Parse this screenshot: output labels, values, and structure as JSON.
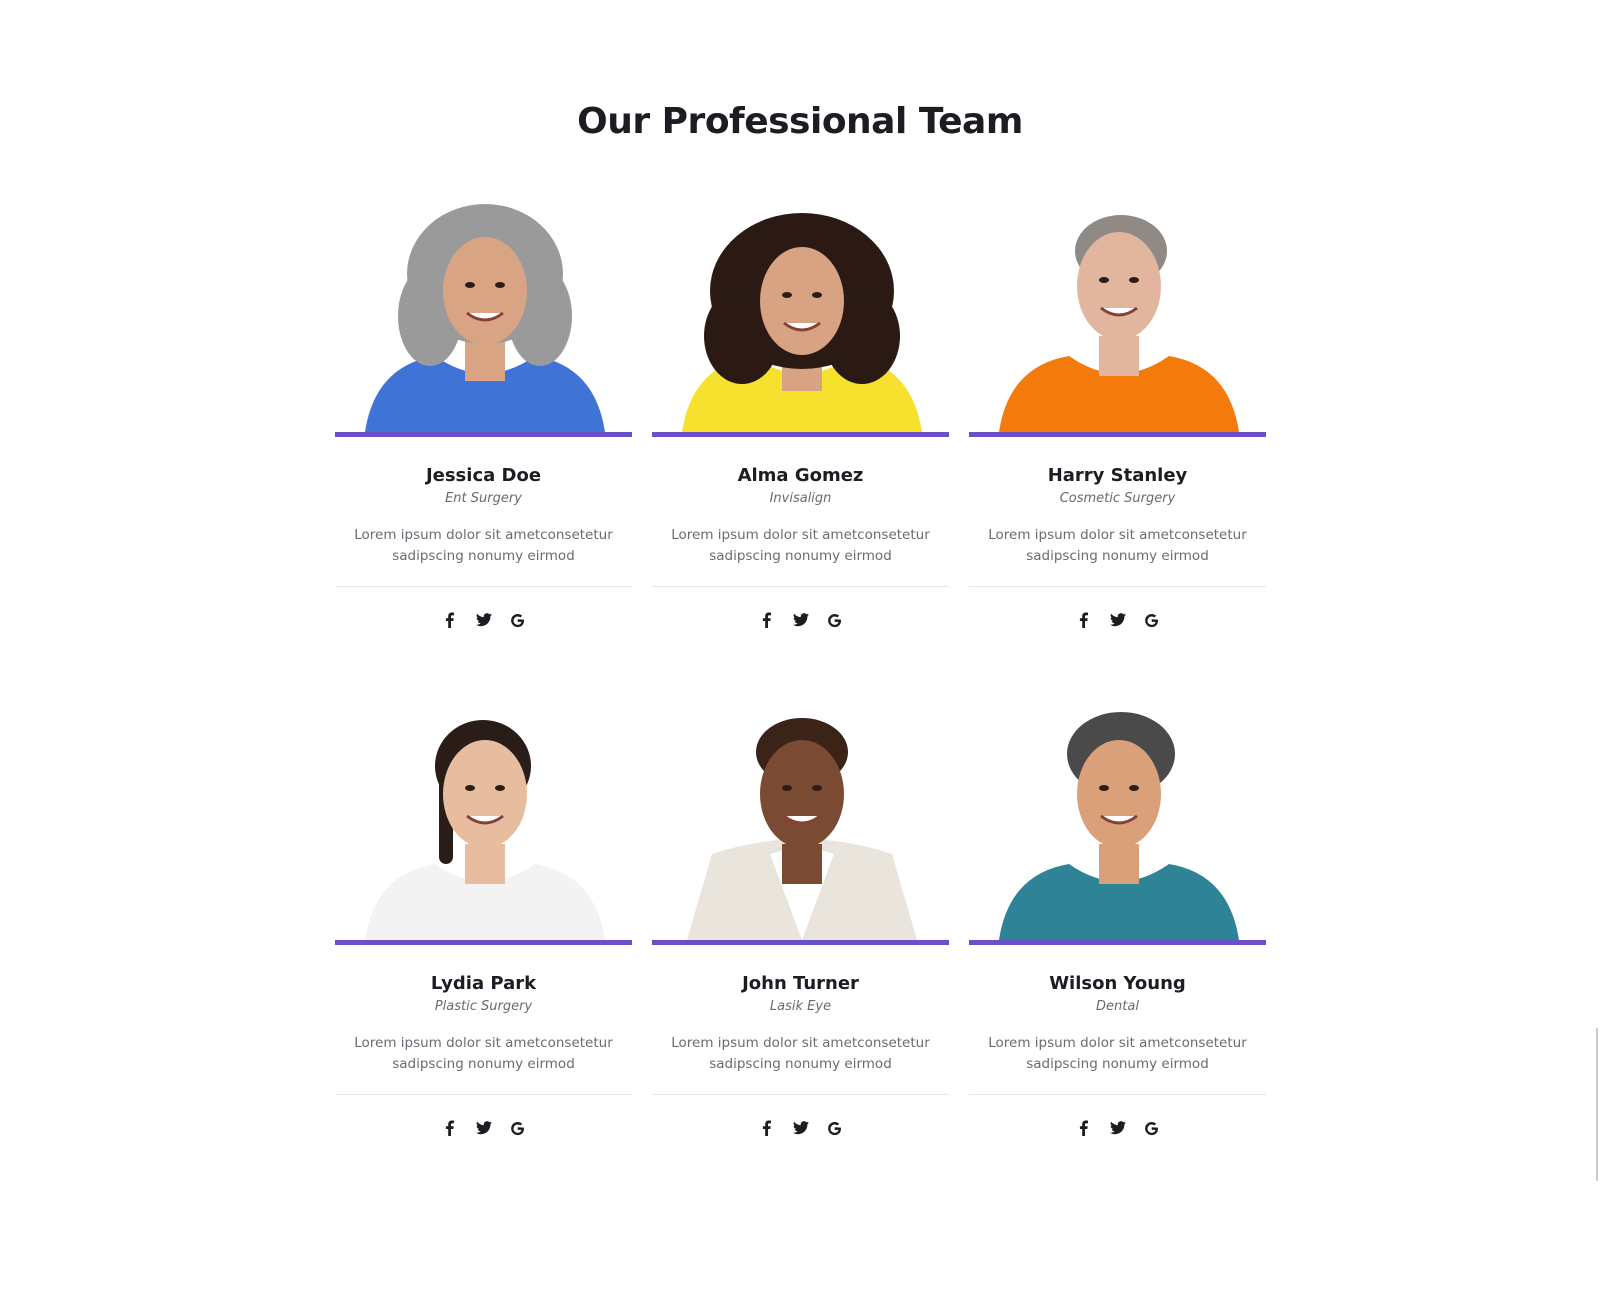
{
  "section": {
    "title": "Our Professional Team"
  },
  "accent_color": "#6a4fc8",
  "members": [
    {
      "name": "Jessica Doe",
      "role": "Ent Surgery",
      "description": "Lorem ipsum dolor sit ametconsetetur sadipscing nonumy eirmod",
      "shirt_color": "#3f73d6",
      "hair_color": "#9a9a9a",
      "skin_color": "#d9a484",
      "socials": [
        "facebook-icon",
        "twitter-icon",
        "google-icon"
      ]
    },
    {
      "name": "Alma Gomez",
      "role": "Invisalign",
      "description": "Lorem ipsum dolor sit ametconsetetur sadipscing nonumy eirmod",
      "shirt_color": "#f6e22e",
      "hair_color": "#2b1a14",
      "skin_color": "#d8a383",
      "socials": [
        "facebook-icon",
        "twitter-icon",
        "google-icon"
      ]
    },
    {
      "name": "Harry Stanley",
      "role": "Cosmetic Surgery",
      "description": "Lorem ipsum dolor sit ametconsetetur sadipscing nonumy eirmod",
      "shirt_color": "#f57a0c",
      "hair_color": "#8f8a86",
      "skin_color": "#e2b69e",
      "socials": [
        "facebook-icon",
        "twitter-icon",
        "google-icon"
      ]
    },
    {
      "name": "Lydia Park",
      "role": "Plastic Surgery",
      "description": "Lorem ipsum dolor sit ametconsetetur sadipscing nonumy eirmod",
      "shirt_color": "#f3f3f3",
      "hair_color": "#2a1c16",
      "skin_color": "#e8bd9f",
      "socials": [
        "facebook-icon",
        "twitter-icon",
        "google-icon"
      ]
    },
    {
      "name": "John Turner",
      "role": "Lasik Eye",
      "description": "Lorem ipsum dolor sit ametconsetetur sadipscing nonumy eirmod",
      "shirt_color": "#e9e4dc",
      "hair_color": "#3b2318",
      "skin_color": "#7a4a33",
      "socials": [
        "facebook-icon",
        "twitter-icon",
        "google-icon"
      ]
    },
    {
      "name": "Wilson Young",
      "role": "Dental",
      "description": "Lorem ipsum dolor sit ametconsetetur sadipscing nonumy eirmod",
      "shirt_color": "#2e8496",
      "hair_color": "#4a4a4a",
      "skin_color": "#d9a07a",
      "socials": [
        "facebook-icon",
        "twitter-icon",
        "google-icon"
      ]
    }
  ]
}
